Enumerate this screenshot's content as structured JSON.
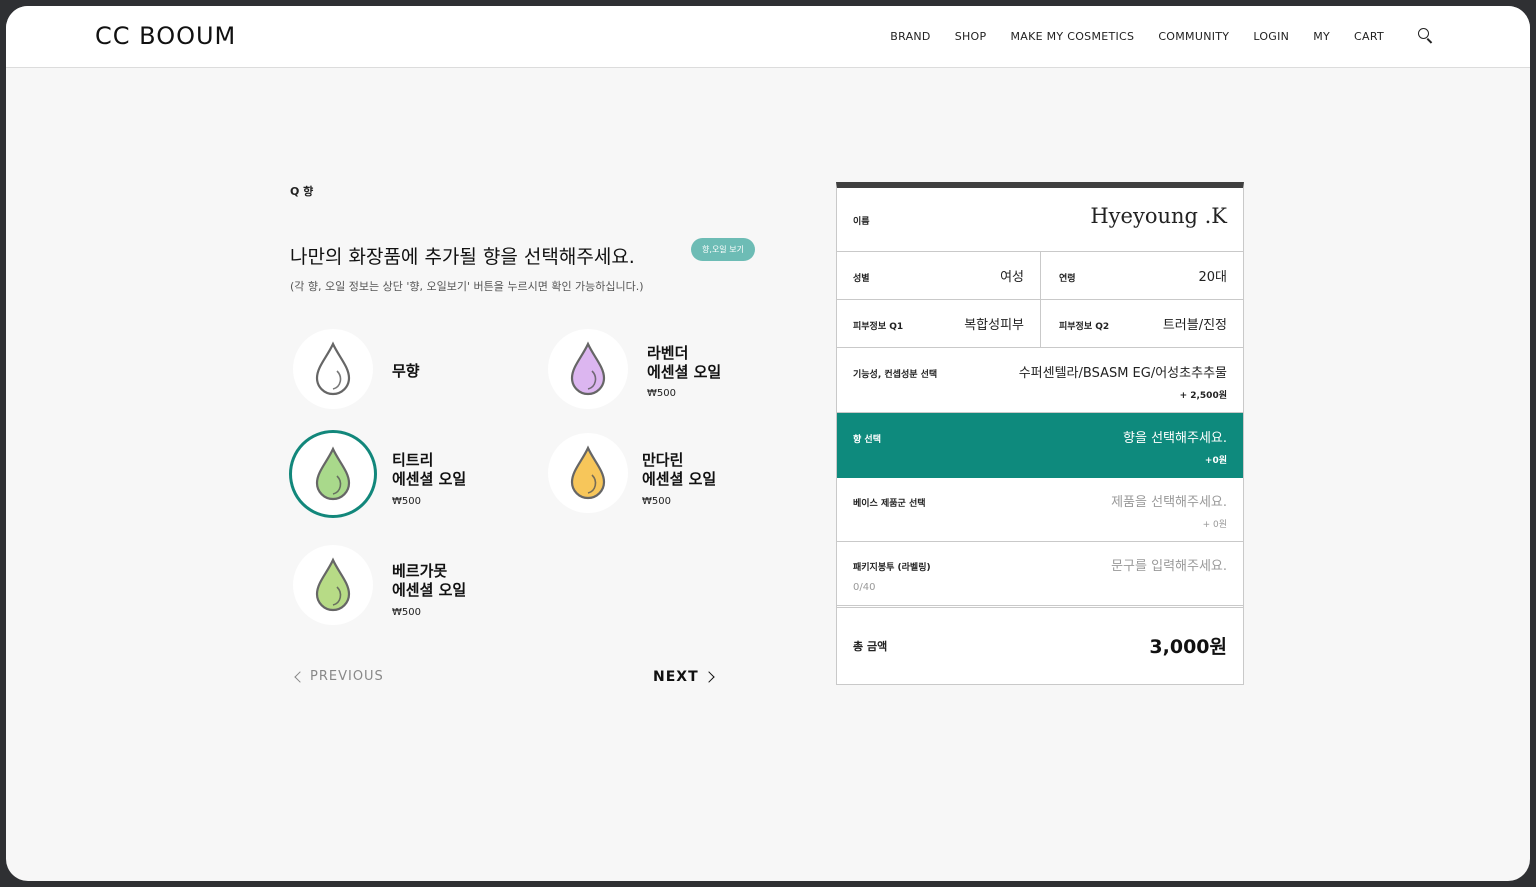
{
  "header": {
    "logo": "CC BOOUM",
    "nav": [
      "BRAND",
      "SHOP",
      "MAKE MY COSMETICS",
      "COMMUNITY",
      "LOGIN",
      "MY",
      "CART"
    ]
  },
  "question": {
    "label": "Q 향",
    "heading": "나만의 화장품에 추가될 향을 선택해주세요.",
    "info_button": "향,오일 보기",
    "subtext": "(각 향, 오일 정보는 상단 '향, 오일보기' 버튼을 누르시면 확인 가능하십니다.)"
  },
  "options": [
    {
      "name_line1": "무향",
      "name_line2": "",
      "price": "",
      "color": "#ffffff",
      "selected": false
    },
    {
      "name_line1": "라벤더",
      "name_line2": "에센셜 오일",
      "price": "₩500",
      "color": "#dcb6f0",
      "selected": false
    },
    {
      "name_line1": "티트리",
      "name_line2": "에센셜 오일",
      "price": "₩500",
      "color": "#a9d98b",
      "selected": true
    },
    {
      "name_line1": "만다린",
      "name_line2": "에센셜 오일",
      "price": "₩500",
      "color": "#f7c65a",
      "selected": false
    },
    {
      "name_line1": "베르가못",
      "name_line2": "에센셜 오일",
      "price": "₩500",
      "color": "#b7db86",
      "selected": false
    }
  ],
  "navigation": {
    "previous": "PREVIOUS",
    "next": "NEXT"
  },
  "summary": {
    "name_label": "이름",
    "name_value": "Hyeyoung .K",
    "gender_label": "성별",
    "gender_value": "여성",
    "age_label": "연령",
    "age_value": "20대",
    "skin_q1_label": "피부정보 Q1",
    "skin_q1_value": "복합성피부",
    "skin_q2_label": "피부정보 Q2",
    "skin_q2_value": "트러블/진정",
    "function_label": "기능성, 컨셉성분 선택",
    "function_value": "수퍼센텔라/BSASM EG/어성초추추물",
    "function_price": "+ 2,500원",
    "scent_label": "향 선택",
    "scent_value": "향을 선택해주세요.",
    "scent_price": "+0원",
    "base_label": "베이스 제품군 선택",
    "base_value": "제품을 선택해주세요.",
    "base_price": "+ 0원",
    "package_label": "패키지봉투 (라벨링)",
    "package_placeholder": "문구를 입력해주세요.",
    "package_count": "0/40",
    "total_label": "총 금액",
    "total_value": "3,000원"
  },
  "colors": {
    "accent": "#0e8a7d",
    "pill": "#6dbcb5",
    "selected_ring": "#12877b"
  }
}
